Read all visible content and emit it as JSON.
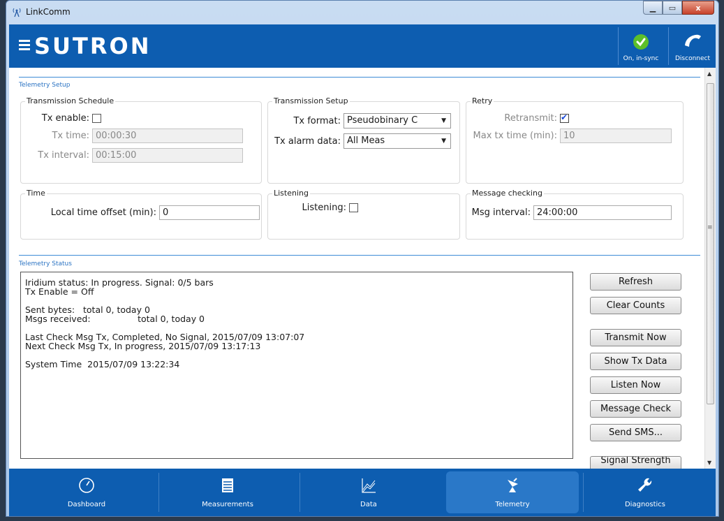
{
  "window": {
    "title": "LinkComm",
    "controls": {
      "minimize": "▁",
      "maximize": "▭",
      "close": "x"
    }
  },
  "header": {
    "brand": "SUTRON",
    "sync_label": "On, in-sync",
    "disconnect_label": "Disconnect",
    "colors": {
      "bar": "#0d5db0",
      "sync_ok": "#5cbf2a"
    }
  },
  "telemetry_setup": {
    "section_title": "Telemetry Setup",
    "transmission_schedule": {
      "title": "Transmission Schedule",
      "tx_enable_label": "Tx enable:",
      "tx_enable_checked": false,
      "tx_time_label": "Tx time:",
      "tx_time_value": "00:00:30",
      "tx_interval_label": "Tx interval:",
      "tx_interval_value": "00:15:00"
    },
    "transmission_setup": {
      "title": "Transmission Setup",
      "tx_format_label": "Tx format:",
      "tx_format_value": "Pseudobinary C",
      "tx_alarm_label": "Tx alarm data:",
      "tx_alarm_value": "All Meas"
    },
    "retry": {
      "title": "Retry",
      "retransmit_label": "Retransmit:",
      "retransmit_checked": true,
      "max_tx_label": "Max tx time (min):",
      "max_tx_value": "10"
    },
    "time": {
      "title": "Time",
      "offset_label": "Local time offset (min):",
      "offset_value": "0"
    },
    "listening": {
      "title": "Listening",
      "listening_label": "Listening:",
      "listening_checked": false
    },
    "message_checking": {
      "title": "Message checking",
      "msg_interval_label": "Msg interval:",
      "msg_interval_value": "24:00:00"
    }
  },
  "telemetry_status": {
    "section_title": "Telemetry Status",
    "lines": {
      "iridium": "Iridium status: In progress. Signal: 0/5 bars",
      "tx_enable": "Tx Enable = Off",
      "sent_bytes": "Sent bytes:   total 0, today 0",
      "msgs_received": "Msgs received:                 total 0, today 0",
      "last_check": "Last Check Msg Tx, Completed, No Signal, 2015/07/09 13:07:07",
      "next_check": "Next Check Msg Tx, In progress, 2015/07/09 13:17:13",
      "system_time": "System Time  2015/07/09 13:22:34"
    },
    "buttons": {
      "refresh": "Refresh",
      "clear_counts": "Clear Counts",
      "transmit_now": "Transmit Now",
      "show_tx_data": "Show Tx Data",
      "listen_now": "Listen Now",
      "message_check": "Message Check",
      "send_sms": "Send SMS...",
      "signal_strength": "Signal Strength"
    }
  },
  "navbar": {
    "items": [
      {
        "label": "Dashboard",
        "icon": "dashboard-gauge-icon"
      },
      {
        "label": "Measurements",
        "icon": "measurements-list-icon"
      },
      {
        "label": "Data",
        "icon": "data-chart-icon"
      },
      {
        "label": "Telemetry",
        "icon": "telemetry-satellite-icon",
        "active": true
      },
      {
        "label": "Diagnostics",
        "icon": "diagnostics-wrench-icon"
      }
    ]
  }
}
